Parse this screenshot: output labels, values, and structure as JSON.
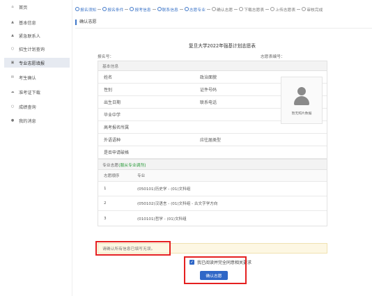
{
  "sidebar": {
    "items": [
      {
        "label": "首页",
        "icon": "home-icon",
        "glyph": "⌂"
      },
      {
        "label": "基本信息",
        "icon": "user-icon",
        "glyph": "▲"
      },
      {
        "label": "紧急联系人",
        "icon": "user-icon",
        "glyph": "▲"
      },
      {
        "label": "招生计划查询",
        "icon": "search-icon",
        "glyph": "○"
      },
      {
        "label": "专业志愿填报",
        "icon": "edit-icon",
        "glyph": "▣"
      },
      {
        "label": "考生确认",
        "icon": "mail-icon",
        "glyph": "✉"
      },
      {
        "label": "准考证下载",
        "icon": "cloud-icon",
        "glyph": "☁"
      },
      {
        "label": "成绩查询",
        "icon": "search-icon",
        "glyph": "○"
      },
      {
        "label": "我的消息",
        "icon": "bell-icon",
        "glyph": "●"
      }
    ]
  },
  "steps": [
    {
      "label": "报名须知",
      "state": "done"
    },
    {
      "label": "报名条件",
      "state": "done"
    },
    {
      "label": "报考信息",
      "state": "done"
    },
    {
      "label": "联系信息",
      "state": "done"
    },
    {
      "label": "志愿专业",
      "state": "done"
    },
    {
      "label": "确认志愿",
      "state": "current"
    },
    {
      "label": "下载志愿表",
      "state": "todo"
    },
    {
      "label": "上传志愿表",
      "state": "todo"
    },
    {
      "label": "审核完成",
      "state": "todo"
    }
  ],
  "page_title": "确认志愿",
  "form": {
    "title": "复旦大学2022年强基计划志愿表",
    "left_meta": "报名号：",
    "right_meta": "志愿表编号：",
    "basic_section": "基本信息",
    "fields": [
      {
        "label": "姓名",
        "label2": "政治面貌"
      },
      {
        "label": "性别",
        "label2": "证件号码"
      },
      {
        "label": "出生日期",
        "label2": "联系电话"
      },
      {
        "label": "毕业中学",
        "label2": ""
      },
      {
        "label": "高考报名所属",
        "label2": ""
      },
      {
        "label": "外语语种",
        "label2": "应往届类型"
      },
      {
        "label": "是否申请破格",
        "label2": ""
      }
    ],
    "photo_text": "暂无照片数据",
    "volunteer_section": "专业志愿",
    "volunteer_note": "(服从专业调剂)",
    "vol_headers": [
      "志愿顺序",
      "专业"
    ],
    "volunteers": [
      {
        "order": "1",
        "major": "(050101)历史学 - (01)文科组"
      },
      {
        "order": "2",
        "major": "(050102)汉语言 - (01)文科组 - 古文字学方向"
      },
      {
        "order": "3",
        "major": "(010101)哲学 - (01)文科组"
      }
    ]
  },
  "notice": "请确认所有信息已填写无误。",
  "agree_label": "我已阅读并完全同意相关要求",
  "confirm_button": "确认志愿"
}
